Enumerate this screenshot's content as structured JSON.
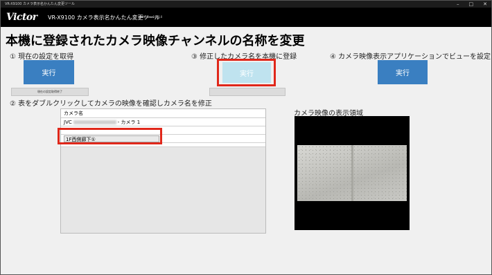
{
  "window": {
    "title": "VR-X9100 カメラ表示名かんたん変更ツール",
    "controls": [
      "–",
      "□",
      "✕"
    ]
  },
  "header": {
    "logo": "Victor",
    "app_name": "VR-X9100 カメラ表示名かんたん変更ツール",
    "version": "Version: 0.0.0.0"
  },
  "main": {
    "title": "本機に登録されたカメラ映像チャンネルの名称を変更",
    "step1": {
      "label": "① 現在の設定を取得",
      "button": "実行",
      "status": "現在の設定取得終了"
    },
    "step2": {
      "label": "② 表をダブルクリックしてカメラの映像を確認しカメラ名を修正"
    },
    "step3": {
      "label": "③ 修正したカメラ名を本機に登録",
      "button": "実行"
    },
    "step4": {
      "label": "④ カメラ映像表示アプリケーションでビューを設定",
      "button": "実行"
    },
    "grid": {
      "header": "カメラ名",
      "rows": [
        {
          "prefix": "JVC",
          "suffix": "- カメラ 1"
        },
        {
          "editing_value": "1F西側廊下①"
        }
      ]
    },
    "display": {
      "label": "カメラ映像の表示領域"
    }
  },
  "colors": {
    "accent": "#3a7fc1",
    "highlight": "#e0271a",
    "header_bg": "#000000"
  }
}
